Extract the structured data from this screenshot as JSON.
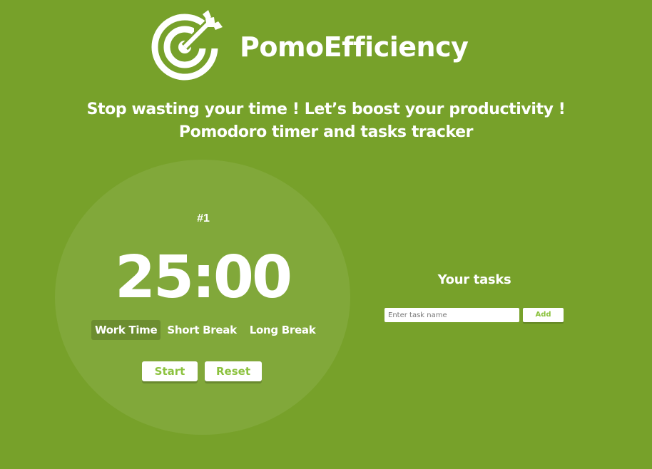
{
  "app": {
    "title": "PomoEfficiency",
    "logo_icon": "target-arrow-icon"
  },
  "tagline": {
    "line1": "Stop wasting your time ! Let’s boost your productivity !",
    "line2": "Pomodoro timer and tasks tracker"
  },
  "timer": {
    "session_label": "#1",
    "time": "25:00",
    "modes": [
      {
        "label": "Work Time",
        "active": true
      },
      {
        "label": "Short Break",
        "active": false
      },
      {
        "label": "Long Break",
        "active": false
      }
    ],
    "start_label": "Start",
    "reset_label": "Reset"
  },
  "tasks": {
    "title": "Your tasks",
    "input_placeholder": "Enter task name",
    "input_value": "",
    "add_label": "Add"
  },
  "colors": {
    "background": "#77a12a",
    "accent": "#8cc23f",
    "text": "#ffffff"
  }
}
